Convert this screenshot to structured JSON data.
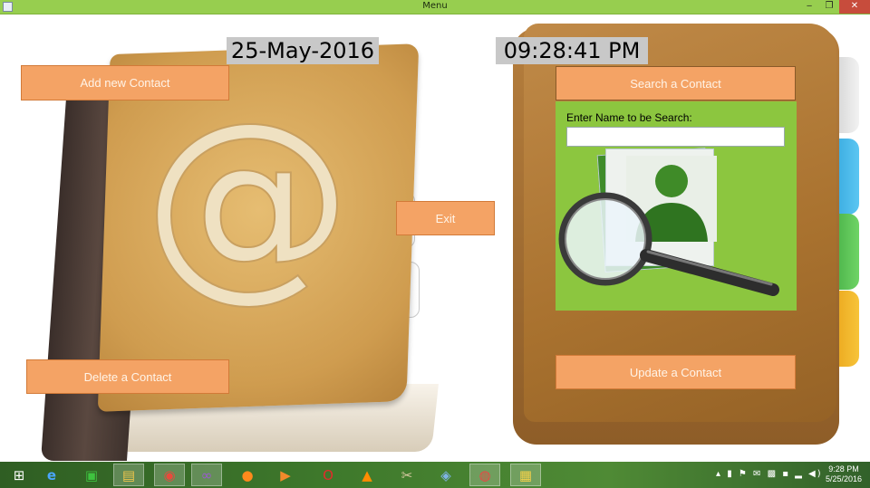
{
  "window": {
    "title": "Menu",
    "minimize_glyph": "‒",
    "maximize_glyph": "❐",
    "close_glyph": "✕"
  },
  "header": {
    "date": "25-May-2016",
    "time": "09:28:41 PM"
  },
  "buttons": {
    "add": "Add new Contact",
    "delete": "Delete a Contact",
    "exit": "Exit",
    "search": "Search a Contact",
    "update": "Update a Contact"
  },
  "search_panel": {
    "label": "Enter Name to be Search:",
    "input_value": ""
  },
  "taskbar": {
    "clock_time": "9:28 PM",
    "clock_date": "5/25/2016",
    "icons": [
      "windows-start-icon",
      "internet-explorer-icon",
      "store-icon",
      "file-explorer-icon",
      "chrome-icon",
      "visual-studio-icon",
      "firefox-icon",
      "media-player-icon",
      "opera-icon",
      "vlc-icon",
      "tools-icon",
      "virtualbox-icon",
      "snipping-tool-icon",
      "app-menu-icon"
    ]
  },
  "colors": {
    "titlebar": "#97ce4f",
    "button_fill": "#f4a365",
    "search_panel": "#8cc63f",
    "label_bg": "#c8c8c8"
  }
}
